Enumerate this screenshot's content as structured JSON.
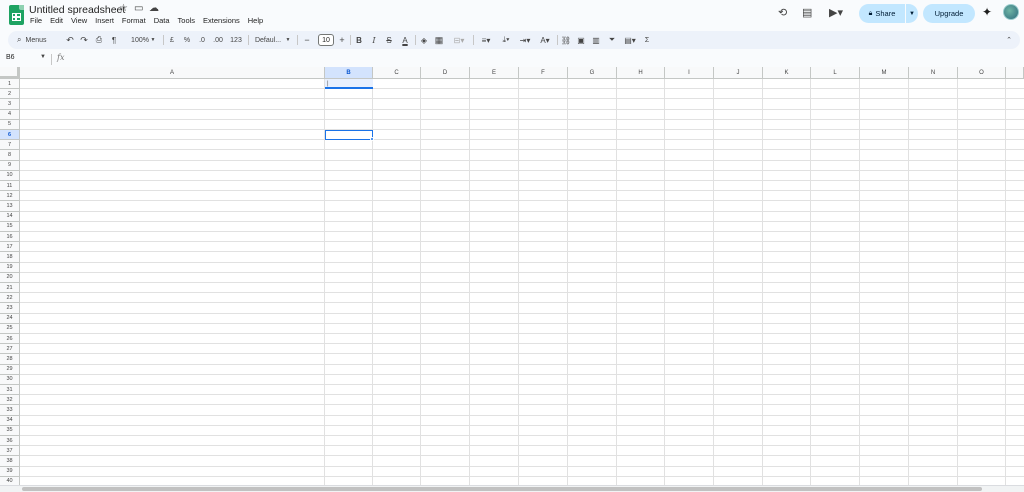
{
  "doc": {
    "title": "Untitled spreadsheet",
    "menus": [
      "File",
      "Edit",
      "View",
      "Insert",
      "Format",
      "Data",
      "Tools",
      "Extensions",
      "Help"
    ]
  },
  "header_actions": {
    "share_label": "Share",
    "upgrade_label": "Upgrade"
  },
  "toolbar": {
    "search_label": "Menus",
    "zoom": "100%",
    "currency": "£",
    "percent": "%",
    "decrease_decimal": ".0",
    "increase_decimal": ".00",
    "number_format": "123",
    "font": "Defaul...",
    "font_size": "10",
    "bold": "B",
    "italic": "I",
    "strike": "S",
    "text_color": "A",
    "sum": "Σ"
  },
  "formula_bar": {
    "name_box": "B6",
    "fx": "fx",
    "content": ""
  },
  "sheet": {
    "columns": [
      "A",
      "B",
      "C",
      "D",
      "E",
      "F",
      "G",
      "H",
      "I",
      "J",
      "K",
      "L",
      "M",
      "N",
      "O"
    ],
    "selected_column": "B",
    "rows": [
      "1",
      "2",
      "3",
      "4",
      "5",
      "6",
      "7",
      "8",
      "9",
      "10",
      "11",
      "12",
      "13",
      "14",
      "15",
      "16",
      "17",
      "18",
      "19",
      "20",
      "21",
      "22",
      "23",
      "24",
      "25",
      "26",
      "27",
      "28",
      "29",
      "30",
      "31",
      "32",
      "33",
      "34",
      "35",
      "36",
      "37",
      "38",
      "39",
      "40"
    ],
    "selected_row": "6",
    "active_cell": "B6",
    "cell_b1": "|"
  }
}
